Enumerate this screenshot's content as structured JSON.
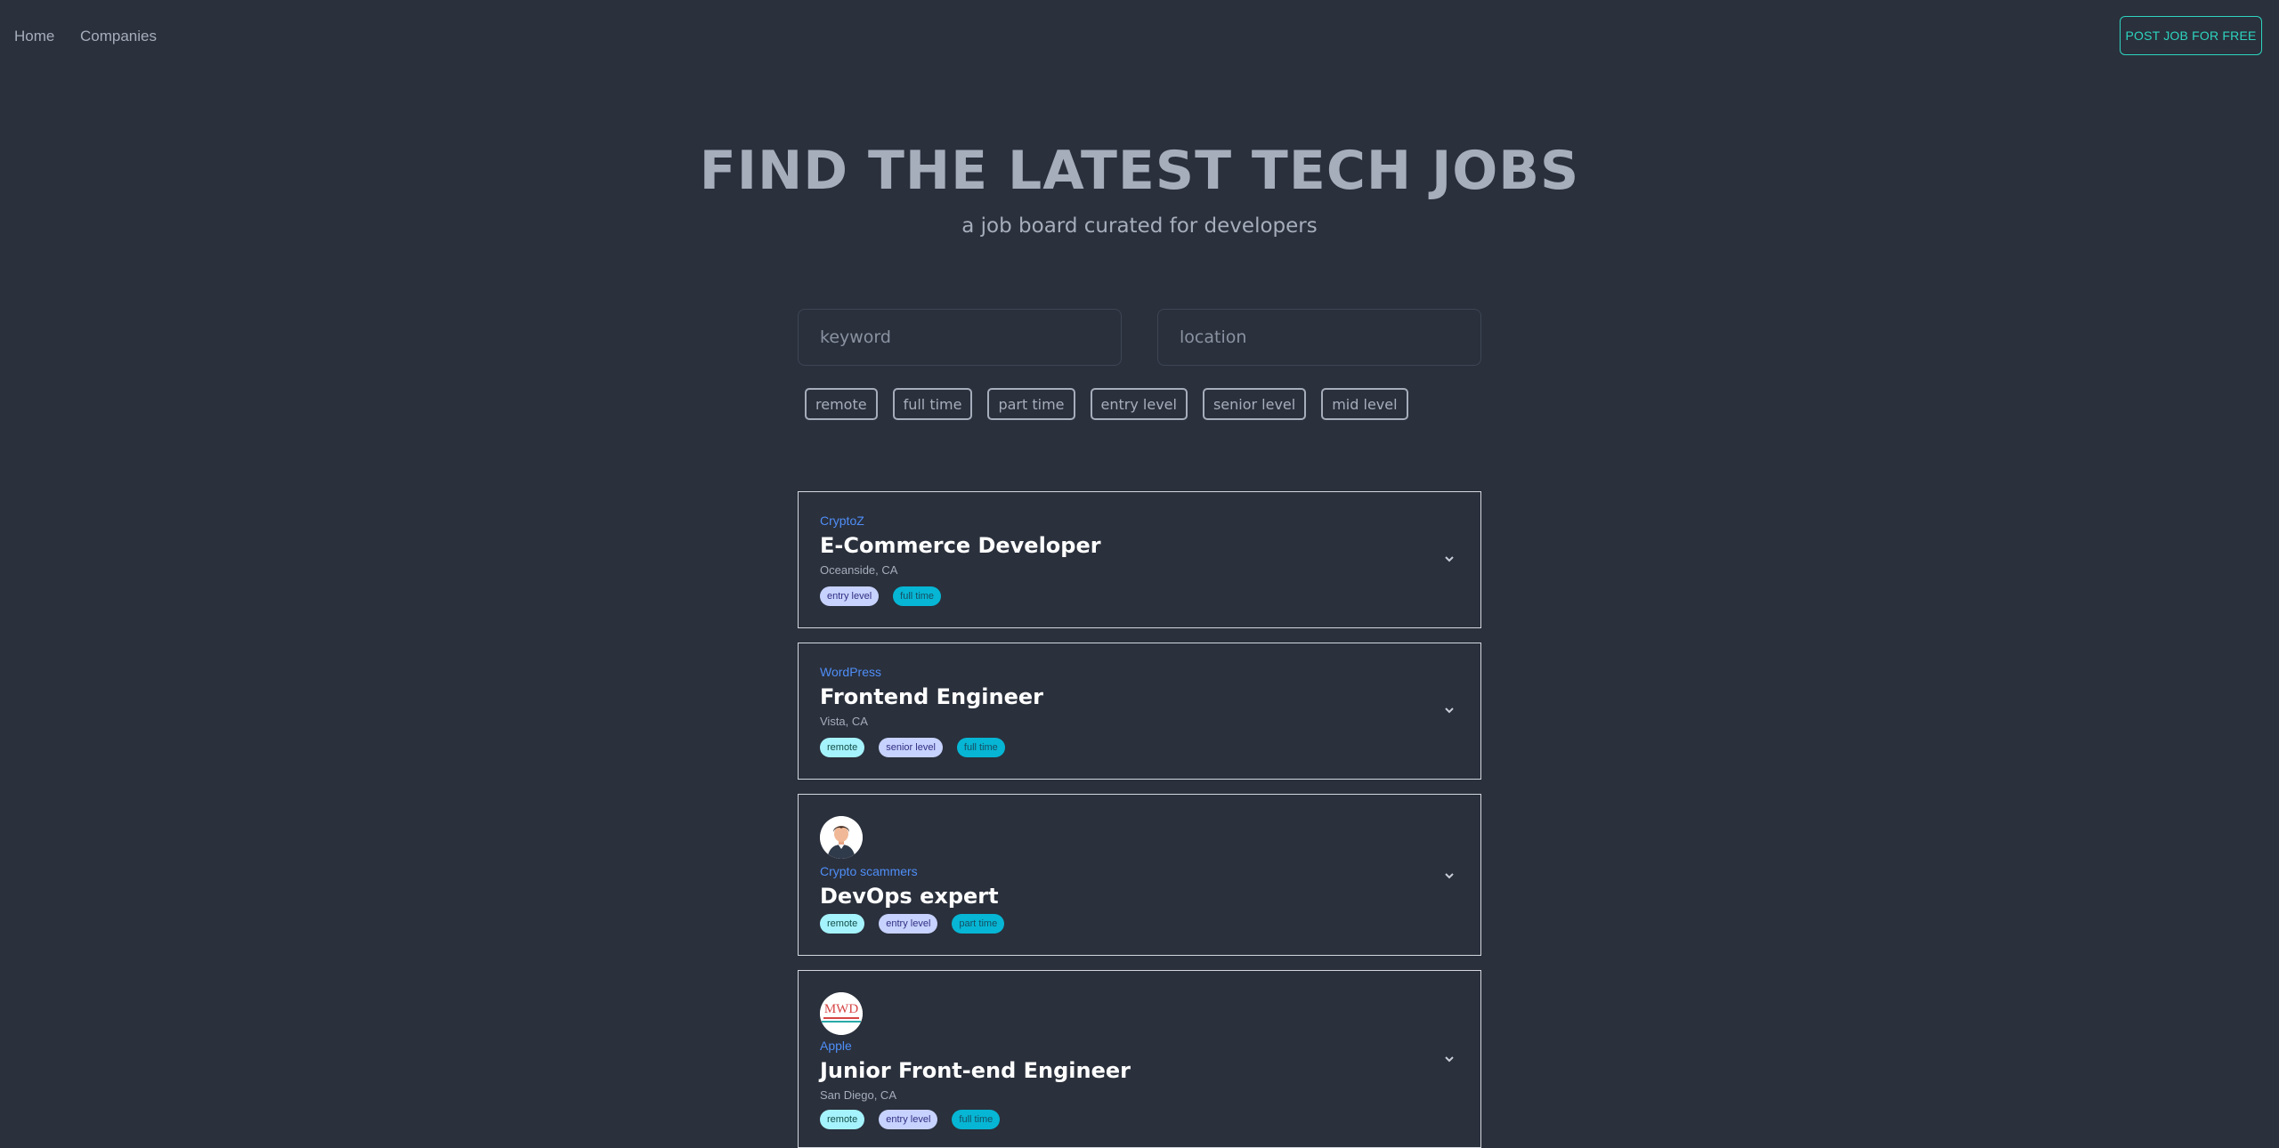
{
  "nav": {
    "home": "Home",
    "companies": "Companies",
    "post_job": "POST JOB FOR FREE"
  },
  "hero": {
    "title": "FIND THE LATEST TECH JOBS",
    "subtitle": "a job board curated for developers"
  },
  "search": {
    "keyword_placeholder": "keyword",
    "location_placeholder": "location"
  },
  "filters": [
    "remote",
    "full time",
    "part time",
    "entry level",
    "senior level",
    "mid level"
  ],
  "jobs": [
    {
      "company": "CryptoZ",
      "title": "E-Commerce Developer",
      "location": "Oceanside, CA",
      "tags": [
        "entry level",
        "full time"
      ]
    },
    {
      "company": "WordPress",
      "title": "Frontend Engineer",
      "location": "Vista, CA",
      "tags": [
        "remote",
        "senior level",
        "full time"
      ]
    },
    {
      "company": "Crypto scammers",
      "title": "DevOps expert",
      "location": "",
      "tags": [
        "remote",
        "entry level",
        "part time"
      ],
      "avatar": "person-avatar-icon"
    },
    {
      "company": "Apple",
      "title": "Junior Front-end Engineer",
      "location": "San Diego, CA",
      "tags": [
        "remote",
        "entry level",
        "full time"
      ],
      "avatar": "mwd-logo",
      "avatar_text": "MWD"
    }
  ],
  "colors": {
    "background": "#2a303c",
    "accent_teal": "#2dd4bf",
    "company_link": "#4f8ef7",
    "tag_remote": "#a5f3fc",
    "tag_level": "#c7d2fe",
    "tag_time": "#06b6d4"
  }
}
